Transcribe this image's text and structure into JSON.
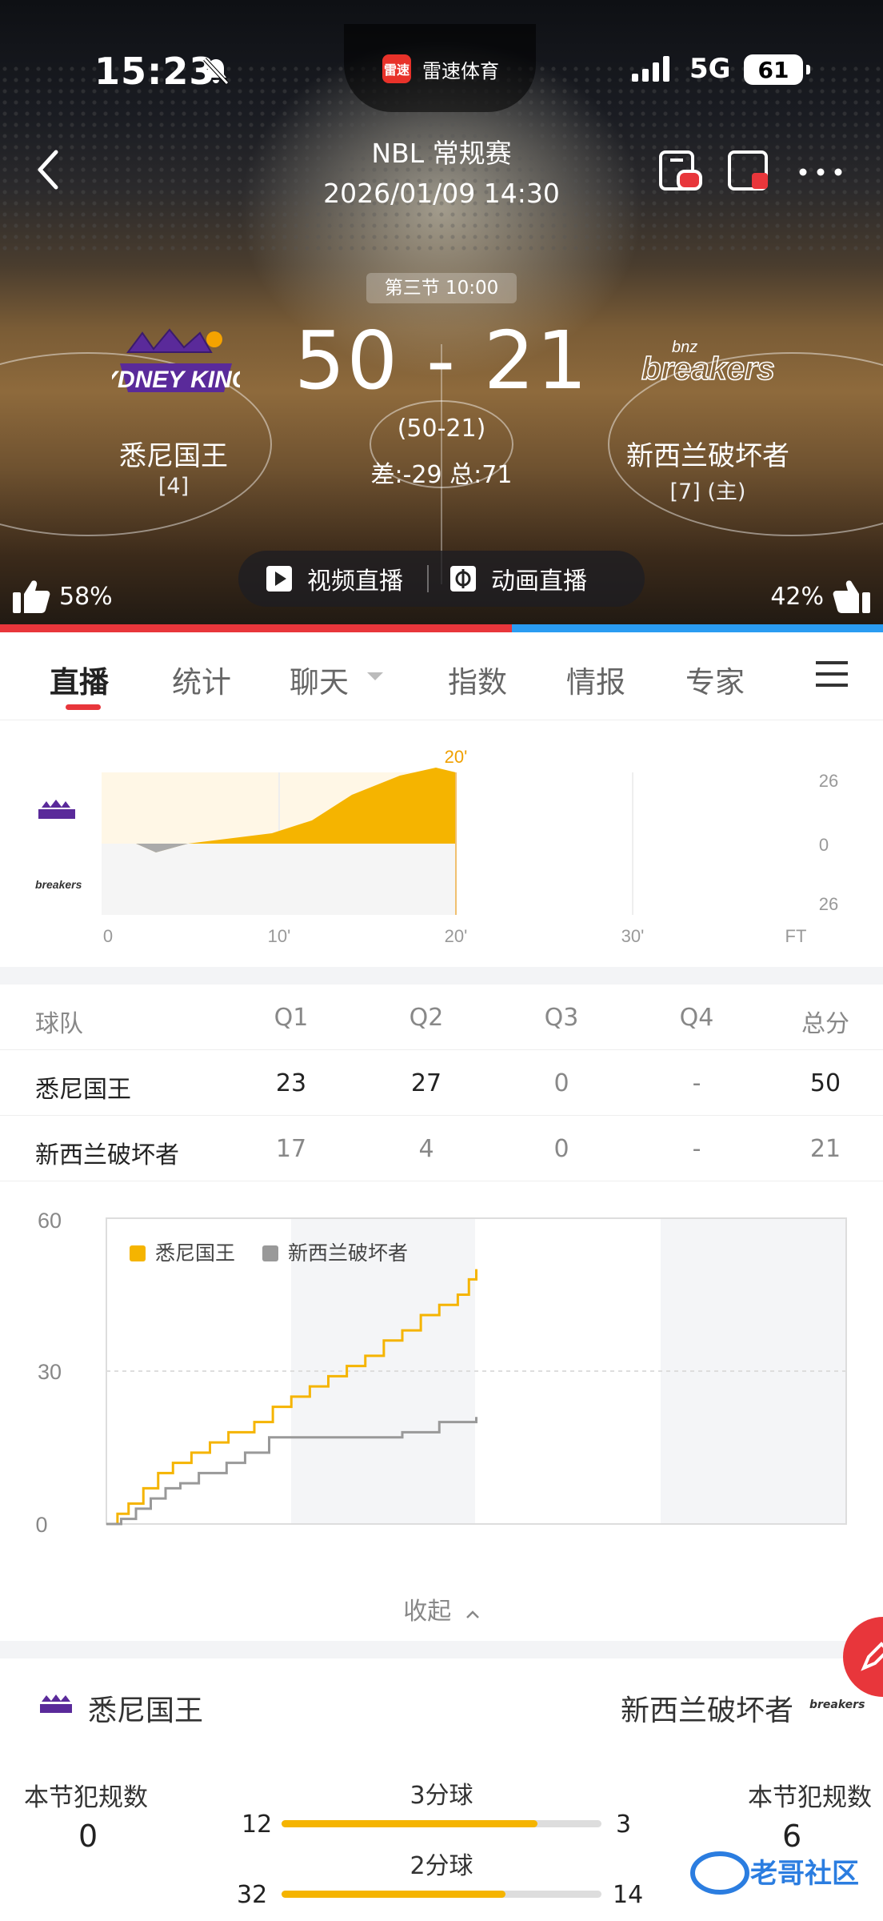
{
  "status": {
    "time": "15:23",
    "app_name": "雷速体育",
    "app_icon_text": "雷速",
    "network": "5G",
    "battery": "61"
  },
  "match": {
    "league": "NBL 常规赛",
    "datetime": "2026/01/09 14:30",
    "period": "第三节 10:00",
    "score": "50 - 21",
    "half_score": "(50-21)",
    "diff_total": "差:-29 总:71"
  },
  "home": {
    "name": "悉尼国王",
    "rank": "[4]",
    "logo": "SYDNEY KINGS",
    "like_pct": "58%"
  },
  "away": {
    "name": "新西兰破坏者",
    "rank": "[7] (主)",
    "logo": "breakers",
    "logo_sup": "bnz",
    "like_pct": "42%"
  },
  "live": {
    "video": "视频直播",
    "animation": "动画直播"
  },
  "tabs": [
    {
      "label": "直播"
    },
    {
      "label": "统计"
    },
    {
      "label": "聊天"
    },
    {
      "label": "指数"
    },
    {
      "label": "情报"
    },
    {
      "label": "专家"
    }
  ],
  "momentum": {
    "current_marker": "20'",
    "x_ticks": [
      "0",
      "10'",
      "20'",
      "30'",
      "FT"
    ],
    "y_ticks": [
      "26",
      "0",
      "26"
    ]
  },
  "quarter_table": {
    "headers": [
      "球队",
      "Q1",
      "Q2",
      "Q3",
      "Q4",
      "总分"
    ],
    "rows": [
      [
        "悉尼国王",
        "23",
        "27",
        "0",
        "-",
        "50"
      ],
      [
        "新西兰破坏者",
        "17",
        "4",
        "0",
        "-",
        "21"
      ]
    ]
  },
  "chart_data": {
    "type": "line",
    "x": [
      "Q1",
      "Q2",
      "Q3",
      "Q4"
    ],
    "ylim": [
      0,
      60
    ],
    "yticks": [
      "0",
      "30",
      "60"
    ],
    "series": [
      {
        "name": "悉尼国王",
        "color": "#f5b400",
        "values": [
          [
            0,
            0
          ],
          [
            0.6,
            2
          ],
          [
            1.2,
            4
          ],
          [
            2,
            7
          ],
          [
            2.8,
            10
          ],
          [
            3.6,
            12
          ],
          [
            4.6,
            14
          ],
          [
            5.6,
            16
          ],
          [
            6.6,
            18
          ],
          [
            8,
            20
          ],
          [
            9,
            23
          ],
          [
            10,
            25
          ],
          [
            11,
            27
          ],
          [
            12,
            29
          ],
          [
            13,
            31
          ],
          [
            14,
            33
          ],
          [
            15,
            36
          ],
          [
            16,
            38
          ],
          [
            17,
            41
          ],
          [
            18,
            43
          ],
          [
            19,
            45
          ],
          [
            19.6,
            48
          ],
          [
            20,
            50
          ]
        ]
      },
      {
        "name": "新西兰破坏者",
        "color": "#999999",
        "values": [
          [
            0,
            0
          ],
          [
            0.8,
            1
          ],
          [
            1.6,
            3
          ],
          [
            2.4,
            5
          ],
          [
            3.2,
            7
          ],
          [
            4,
            8
          ],
          [
            5,
            10
          ],
          [
            6.5,
            12
          ],
          [
            7.5,
            14
          ],
          [
            8.8,
            17
          ],
          [
            10,
            17
          ],
          [
            12,
            17
          ],
          [
            14,
            17
          ],
          [
            16,
            18
          ],
          [
            18,
            20
          ],
          [
            20,
            21
          ]
        ]
      }
    ]
  },
  "collapse_label": "收起",
  "compare": {
    "home_name": "悉尼国王",
    "away_name": "新西兰破坏者",
    "left_label": "本节犯规数",
    "left_value": "0",
    "right_label": "本节犯规数",
    "right_value": "6",
    "rows": [
      {
        "label": "3分球",
        "home": "12",
        "away": "3",
        "ratio": 0.8
      },
      {
        "label": "2分球",
        "home": "32",
        "away": "14",
        "ratio": 0.7
      }
    ]
  },
  "watermark": "老哥社区"
}
